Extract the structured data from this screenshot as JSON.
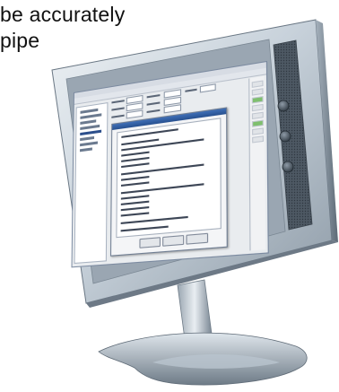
{
  "caption": {
    "line1": "be accurately",
    "line2": "pipe"
  },
  "colors": {
    "bezel": "#c9d3dc",
    "bezel_dark": "#7d8c99",
    "speaker": "#55626e",
    "dialog_title": "#2f5c9f"
  },
  "icons": [
    "monitor-power-button",
    "monitor-control-button"
  ]
}
